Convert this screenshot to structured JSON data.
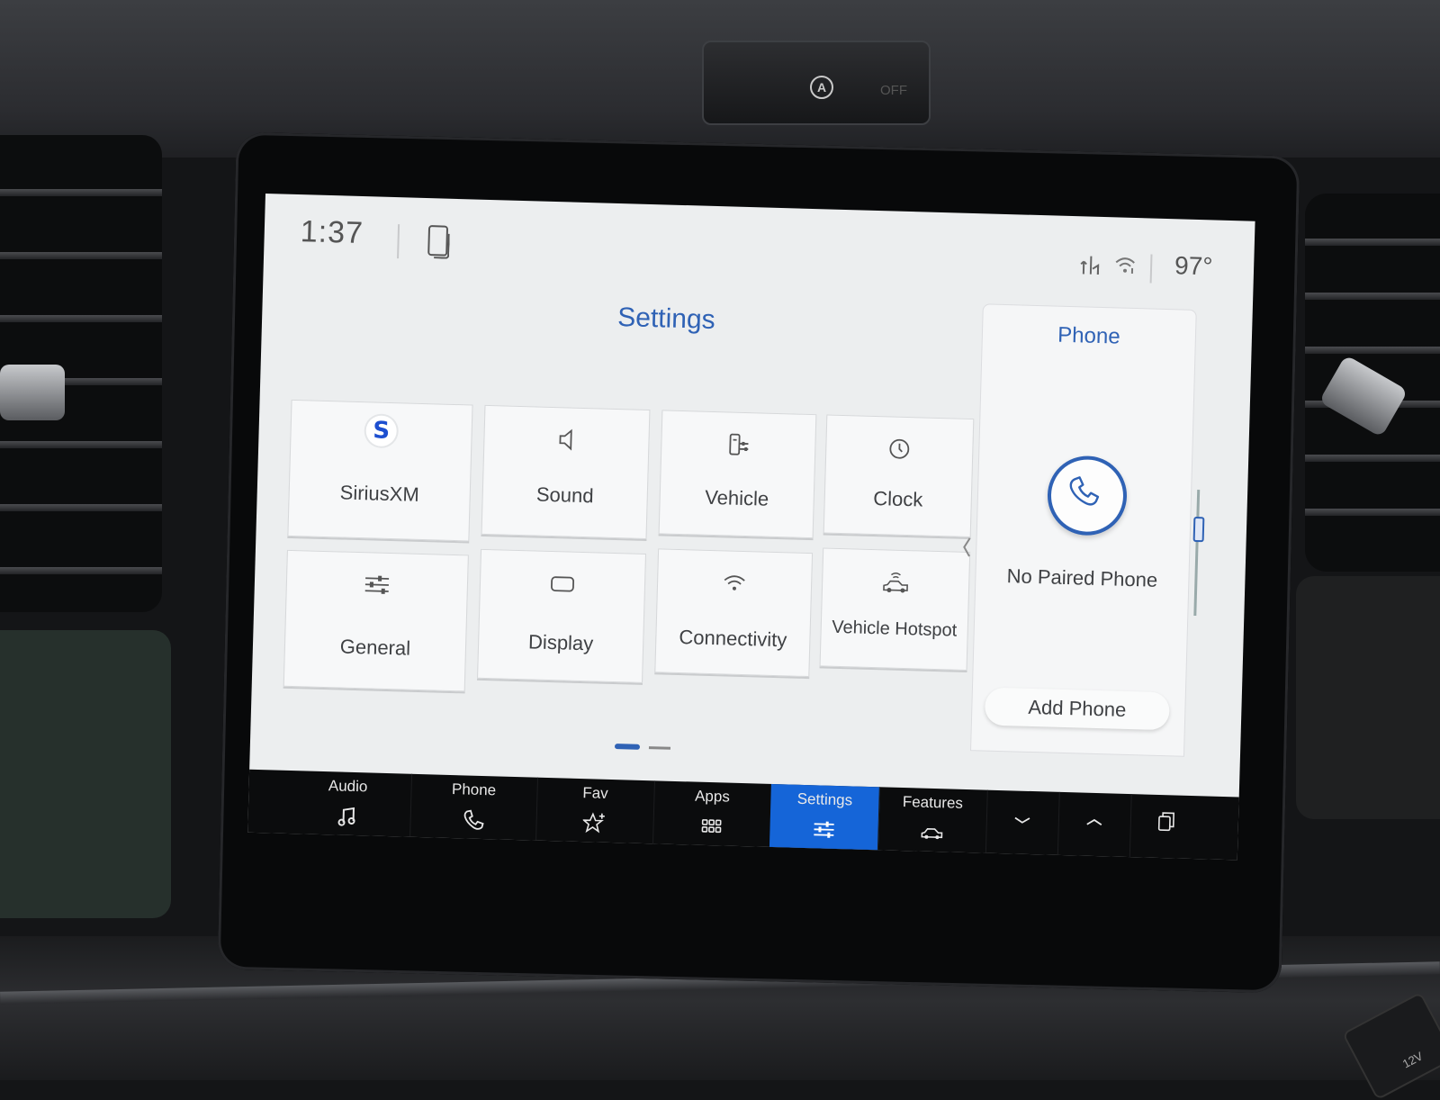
{
  "status_bar": {
    "time": "1:37",
    "temperature": "97°"
  },
  "hazard": {
    "badge": "A",
    "off_label": "OFF"
  },
  "outlet_label": "12V",
  "settings": {
    "title": "Settings",
    "tiles": [
      {
        "label": "SiriusXM",
        "icon": "siriusxm-logo-icon",
        "logo": "S"
      },
      {
        "label": "Sound",
        "icon": "speaker-icon"
      },
      {
        "label": "Vehicle",
        "icon": "vehicle-settings-icon"
      },
      {
        "label": "Clock",
        "icon": "clock-icon"
      },
      {
        "label": "General",
        "icon": "sliders-icon"
      },
      {
        "label": "Display",
        "icon": "display-icon"
      },
      {
        "label": "Connectivity",
        "icon": "wifi-icon"
      },
      {
        "label": "Vehicle Hotspot",
        "icon": "car-hotspot-icon"
      }
    ],
    "page_count": 2,
    "current_page": 1
  },
  "phone_panel": {
    "title": "Phone",
    "status": "No Paired Phone",
    "add_button": "Add Phone"
  },
  "nav": {
    "items": [
      {
        "label": "Audio",
        "icon": "music-note-icon"
      },
      {
        "label": "Phone",
        "icon": "phone-icon"
      },
      {
        "label": "Fav",
        "icon": "star-plus-icon"
      },
      {
        "label": "Apps",
        "icon": "grid-icon"
      },
      {
        "label": "Settings",
        "icon": "sliders-icon",
        "active": true
      },
      {
        "label": "Features",
        "icon": "car-icon"
      }
    ],
    "controls": [
      "chevron-down-icon",
      "chevron-up-icon",
      "overlap-windows-icon"
    ]
  },
  "colors": {
    "accent": "#2f62b5",
    "active_nav": "#1565d8",
    "screen_bg": "#eceeef"
  }
}
